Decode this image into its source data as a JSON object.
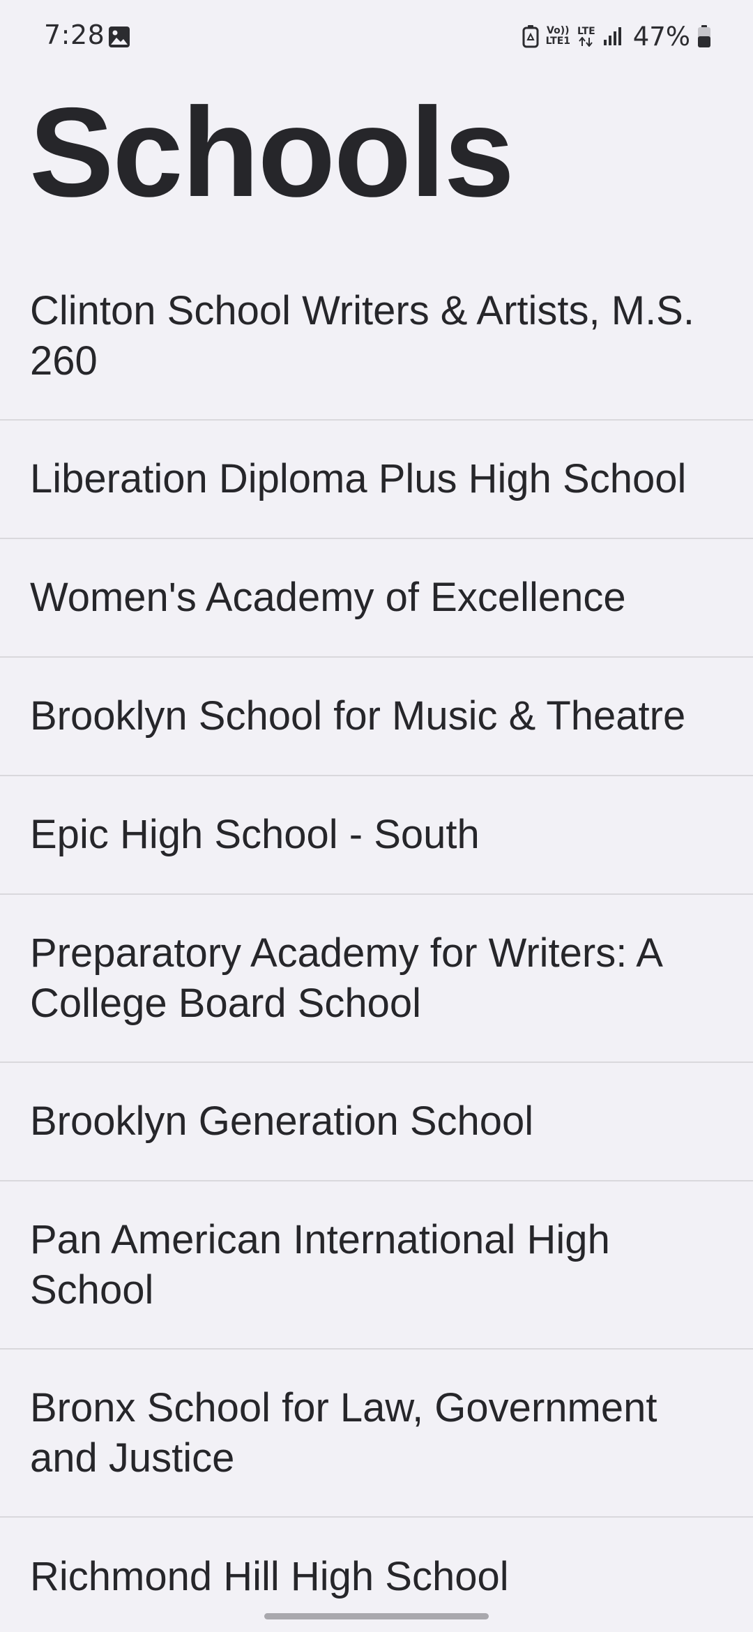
{
  "status_bar": {
    "time": "7:28",
    "volte_top": "Vo))",
    "volte_bottom": "LTE1",
    "network": "LTE",
    "battery_percent": "47%",
    "icons": [
      "image-icon",
      "battery-saver-icon",
      "volte-icon",
      "lte-data-icon",
      "signal-icon",
      "battery-icon"
    ]
  },
  "header": {
    "title": "Schools"
  },
  "schools": [
    {
      "name": "Clinton School Writers & Artists, M.S. 260"
    },
    {
      "name": "Liberation Diploma Plus High School"
    },
    {
      "name": "Women's Academy of Excellence"
    },
    {
      "name": "Brooklyn School for Music & Theatre"
    },
    {
      "name": "Epic High School - South"
    },
    {
      "name": "Preparatory Academy for Writers: A College Board School"
    },
    {
      "name": "Brooklyn Generation School"
    },
    {
      "name": "Pan American International High School"
    },
    {
      "name": "Bronx School for Law, Government and Justice"
    },
    {
      "name": "Richmond Hill High School"
    }
  ],
  "colors": {
    "background": "#f2f1f6",
    "text": "#26262a",
    "divider": "#d9d8dc",
    "home_indicator": "#a9a8ad"
  }
}
